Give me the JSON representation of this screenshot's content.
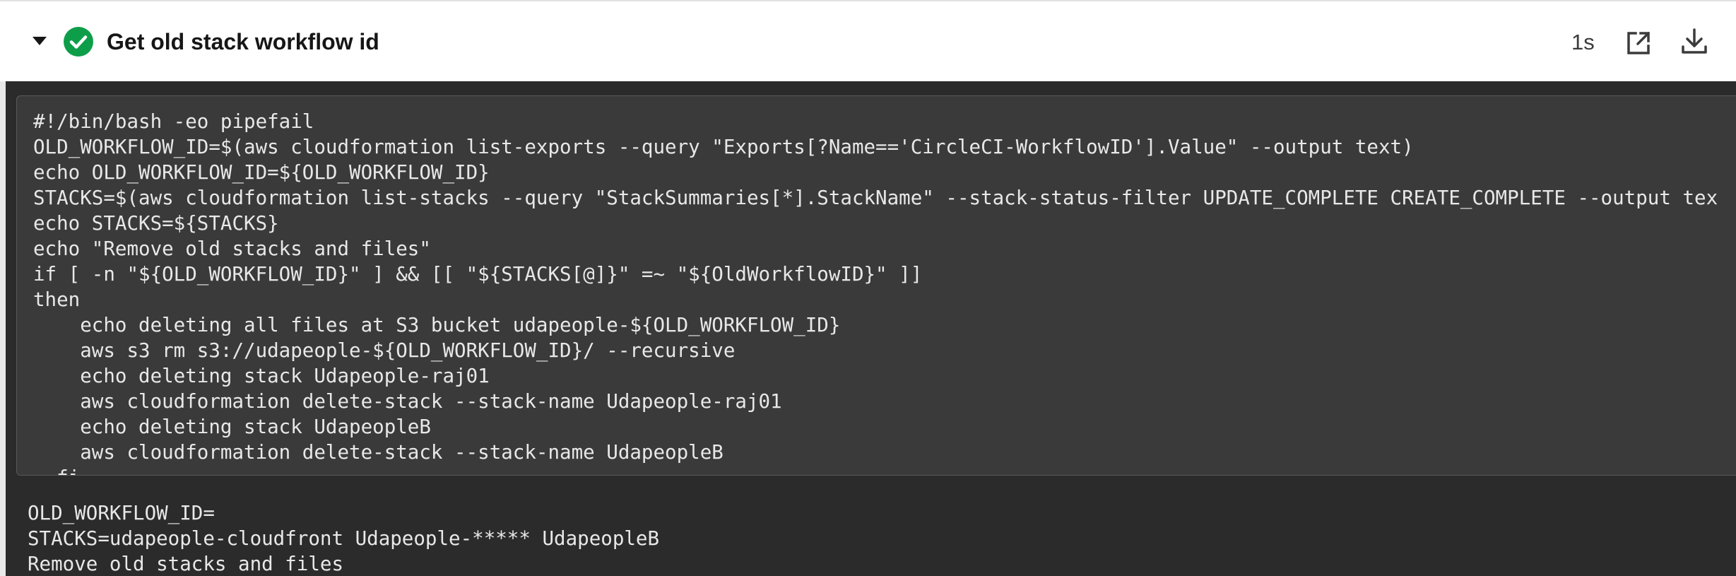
{
  "step": {
    "title": "Get old stack workflow id",
    "duration": "1s",
    "status": "success",
    "status_color": "#0e9e4a",
    "icons": {
      "toggle": "caret-down-icon",
      "status": "check-circle-icon",
      "open": "open-external-icon",
      "download": "download-icon"
    }
  },
  "command": {
    "lines": [
      "#!/bin/bash -eo pipefail",
      "OLD_WORKFLOW_ID=$(aws cloudformation list-exports --query \"Exports[?Name=='CircleCI-WorkflowID'].Value\" --output text)",
      "echo OLD_WORKFLOW_ID=${OLD_WORKFLOW_ID}",
      "STACKS=$(aws cloudformation list-stacks --query \"StackSummaries[*].StackName\" --stack-status-filter UPDATE_COMPLETE CREATE_COMPLETE --output tex",
      "echo STACKS=${STACKS}",
      "echo \"Remove old stacks and files\"",
      "if [ -n \"${OLD_WORKFLOW_ID}\" ] && [[ \"${STACKS[@]}\" =~ \"${OldWorkflowID}\" ]]",
      "then",
      "    echo deleting all files at S3 bucket udapeople-${OLD_WORKFLOW_ID}",
      "    aws s3 rm s3://udapeople-${OLD_WORKFLOW_ID}/ --recursive",
      "    echo deleting stack Udapeople-raj01",
      "    aws cloudformation delete-stack --stack-name Udapeople-raj01",
      "    echo deleting stack UdapeopleB",
      "    aws cloudformation delete-stack --stack-name UdapeopleB",
      "  fi"
    ]
  },
  "output": {
    "lines": [
      "OLD_WORKFLOW_ID=",
      "STACKS=udapeople-cloudfront Udapeople-***** UdapeopleB",
      "Remove old stacks and files"
    ]
  }
}
